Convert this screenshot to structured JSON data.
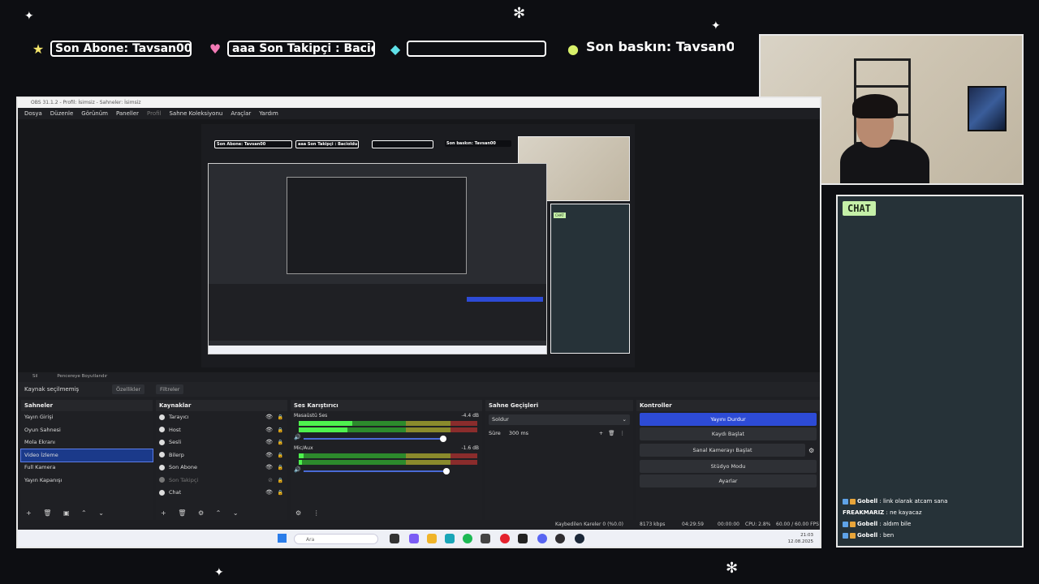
{
  "overlay": {
    "alerts": [
      {
        "icon": "star",
        "text": "Son Abone: Tavsan00"
      },
      {
        "icon": "heart",
        "text": "aaa    Son Takipçi : Bacioldu"
      },
      {
        "icon": "diamond",
        "text": ""
      },
      {
        "icon": "circle",
        "text": "Son baskın: Tavsan00"
      }
    ]
  },
  "chat": {
    "title": "CHAT",
    "messages": [
      {
        "user": "Gobell",
        "text": ": link olarak atcam sana",
        "badges": true
      },
      {
        "user": "FREAKMARIZ",
        "text": ": ne kayacaz",
        "badges": false
      },
      {
        "user": "Gobell",
        "text": ": aldım bile",
        "badges": true
      },
      {
        "user": "Gobell",
        "text": ": ben",
        "badges": true
      }
    ]
  },
  "obs": {
    "window_title": "OBS 31.1.2 - Profil: İsimsiz - Sahneler: İsimsiz",
    "menu": [
      "Dosya",
      "Düzenle",
      "Görünüm",
      "Paneller",
      "Profil",
      "Sahne Koleksiyonu",
      "Araçlar",
      "Yardım"
    ],
    "preview_toolbar": {
      "sil": "Sil",
      "resize": "Pencereye Boyutlandır"
    },
    "source_bar": {
      "no_source": "Kaynak seçilmemiş",
      "properties": "Özellikler",
      "filters": "Filtreler"
    },
    "scenes": {
      "title": "Sahneler",
      "items": [
        "Yayın Girişi",
        "Oyun Sahnesi",
        "Mola Ekranı",
        "Video İzleme",
        "Full Kamera",
        "Yayın Kapanışı"
      ],
      "selected_index": 3
    },
    "sources": {
      "title": "Kaynaklar",
      "items": [
        "Tarayıcı",
        "Host",
        "Sesli",
        "Bilerp",
        "Son Abone",
        "Son Takipçi",
        "Chat"
      ]
    },
    "mixer": {
      "title": "Ses Karıştırıcı",
      "channels": [
        {
          "name": "Masaüstü Ses",
          "db": "-4.4 dB",
          "level": 0.3,
          "volume": 0.95
        },
        {
          "name": "Mic/Aux",
          "db": "-1.6 dB",
          "level": 0.05,
          "volume": 0.97
        }
      ],
      "scale": [
        "-60",
        "-55",
        "-50",
        "-45",
        "-40",
        "-35",
        "-30",
        "-25",
        "-20",
        "-15",
        "-10",
        "-5",
        "0"
      ]
    },
    "transitions": {
      "title": "Sahne Geçişleri",
      "selected": "Soldur",
      "duration_label": "Süre",
      "duration_value": "300 ms"
    },
    "controls": {
      "title": "Kontroller",
      "buttons": [
        "Yayını Durdur",
        "Kaydı Başlat",
        "Sanal Kamerayı Başlat",
        "Stüdyo Modu",
        "Ayarlar"
      ]
    },
    "status": {
      "dropped": "Kaybedilen Kareler 0 (%0.0)",
      "bitrate": "8173 kbps",
      "stream_time": "04:29:59",
      "rec_time": "00:00:00",
      "cpu": "CPU: 2.8%",
      "fps": "60.00 / 60.00 FPS"
    },
    "taskbar": {
      "search": "Ara",
      "time": "21:03",
      "date": "12.08.2025"
    }
  },
  "colors": {
    "accent": "#2d4bd6",
    "chat_bg": "#263238",
    "chat_title_bg": "#c5f0a8",
    "meter_green": "#4ef24e"
  }
}
